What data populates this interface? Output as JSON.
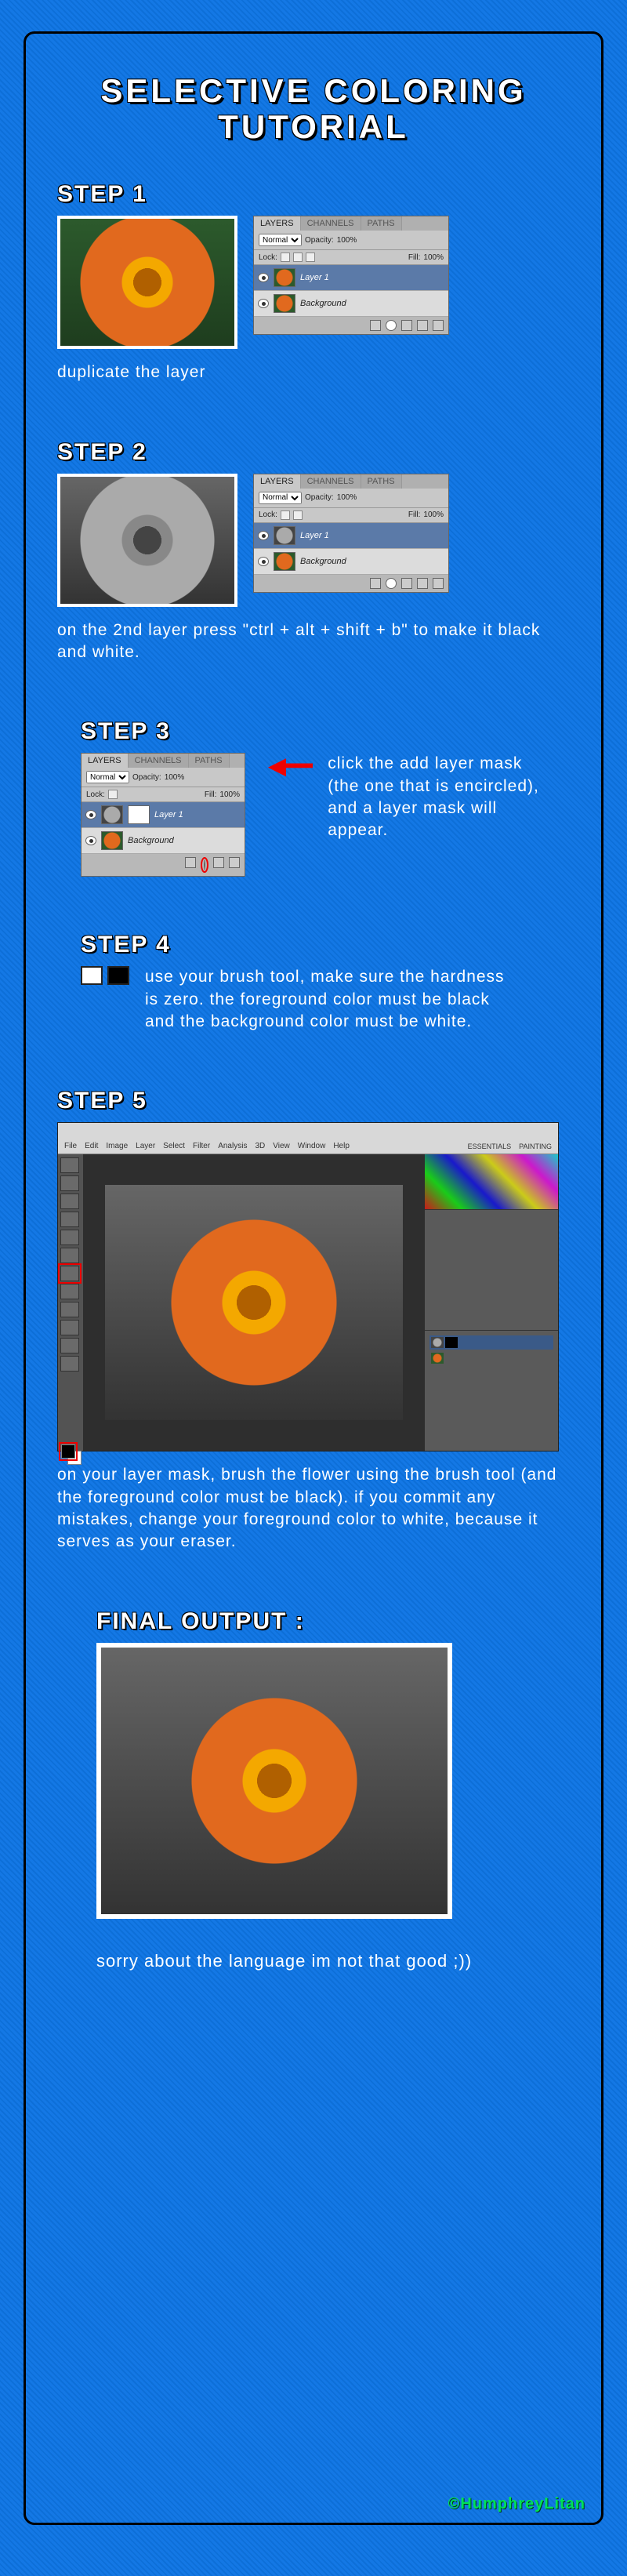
{
  "title_line1": "SELECTIVE  COLORING",
  "title_line2": "TUTORIAL",
  "steps": {
    "s1": {
      "label": "STEP 1",
      "caption": "duplicate the layer"
    },
    "s2": {
      "label": "STEP 2",
      "caption": "on the 2nd layer press \"ctrl + alt + shift + b\" to make it black and white."
    },
    "s3": {
      "label": "STEP 3",
      "caption": "click the add layer mask (the one that is encircled), and a layer mask will appear."
    },
    "s4": {
      "label": "STEP 4",
      "caption": "use your brush tool, make sure the hardness is zero. the foreground color must be black and the background color must be white."
    },
    "s5": {
      "label": "STEP 5",
      "caption": "on your layer mask, brush the flower using the brush tool (and the foreground color must be black). if you commit any mistakes, change your foreground color to white, because it serves as your eraser."
    },
    "final": {
      "label": "FINAL OUTPUT :"
    }
  },
  "layers_panel": {
    "tabs": {
      "layers": "LAYERS",
      "channels": "CHANNELS",
      "paths": "PATHS"
    },
    "blend_mode": "Normal",
    "opacity_label": "Opacity:",
    "opacity_value": "100%",
    "lock_label": "Lock:",
    "fill_label": "Fill:",
    "fill_value": "100%",
    "layer1": "Layer 1",
    "background": "Background"
  },
  "editor": {
    "menu_items": [
      "File",
      "Edit",
      "Image",
      "Layer",
      "Select",
      "Filter",
      "Analysis",
      "3D",
      "View",
      "Window",
      "Help"
    ],
    "top_tabs": [
      "ESSENTIALS",
      "PAINTING"
    ]
  },
  "apology": "sorry about the language im not that good ;))",
  "credit": "©HumphreyLitan"
}
